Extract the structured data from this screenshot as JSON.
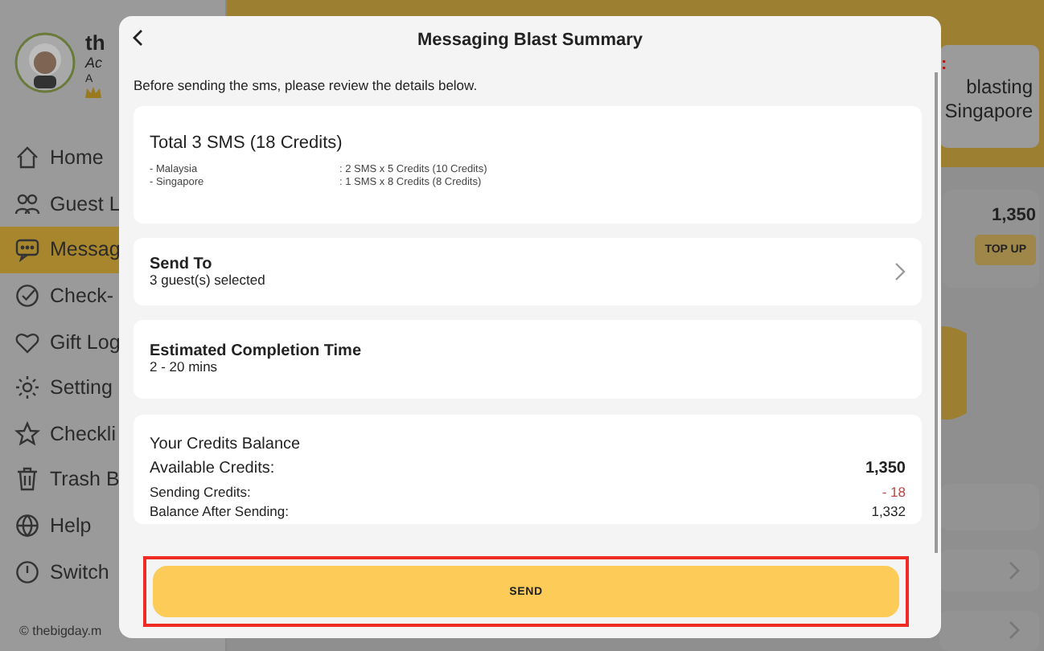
{
  "sidebar": {
    "profile": {
      "name": "th",
      "role": "Ac",
      "line": "A"
    },
    "items": [
      {
        "label": "Home",
        "kind": "home",
        "selected": false
      },
      {
        "label": "Guest L",
        "kind": "guests",
        "selected": false
      },
      {
        "label": "Messag",
        "kind": "message",
        "selected": true
      },
      {
        "label": "Check-",
        "kind": "check",
        "selected": false
      },
      {
        "label": "Gift Log",
        "kind": "heart",
        "selected": false
      },
      {
        "label": "Setting",
        "kind": "gear",
        "selected": false
      },
      {
        "label": "Checkli",
        "kind": "star",
        "selected": false
      },
      {
        "label": "Trash B",
        "kind": "trash",
        "selected": false
      },
      {
        "label": "Help",
        "kind": "globe",
        "selected": false
      },
      {
        "label": "Switch",
        "kind": "power",
        "selected": false
      }
    ],
    "footer": "© thebigday.m"
  },
  "background": {
    "banner_mark": ":",
    "banner_lines": [
      "blasting",
      "Singapore"
    ],
    "credits": "1,350",
    "top_up": "TOP UP"
  },
  "dialog": {
    "title": "Messaging Blast Summary",
    "intro": "Before sending the sms, please review the details below.",
    "summary": {
      "title": "Total 3 SMS (18 Credits)",
      "lines": [
        {
          "country": "- Malaysia",
          "detail": ": 2 SMS x 5 Credits (10 Credits)"
        },
        {
          "country": "- Singapore",
          "detail": ": 1 SMS x 8 Credits (8 Credits)"
        }
      ]
    },
    "send_to": {
      "title": "Send To",
      "subtitle": "3 guest(s) selected"
    },
    "completion": {
      "title": "Estimated Completion Time",
      "value": "2 - 20 mins"
    },
    "balance": {
      "title": "Your Credits Balance",
      "rows": [
        {
          "label": "Available Credits:",
          "value": "1,350",
          "kind": "total"
        },
        {
          "label": "Sending Credits:",
          "value": "- 18",
          "kind": "deduct"
        },
        {
          "label": "Balance After Sending:",
          "value": "1,332",
          "kind": "result"
        }
      ]
    },
    "send_button": {
      "label": "SEND",
      "highlighted": true
    }
  }
}
